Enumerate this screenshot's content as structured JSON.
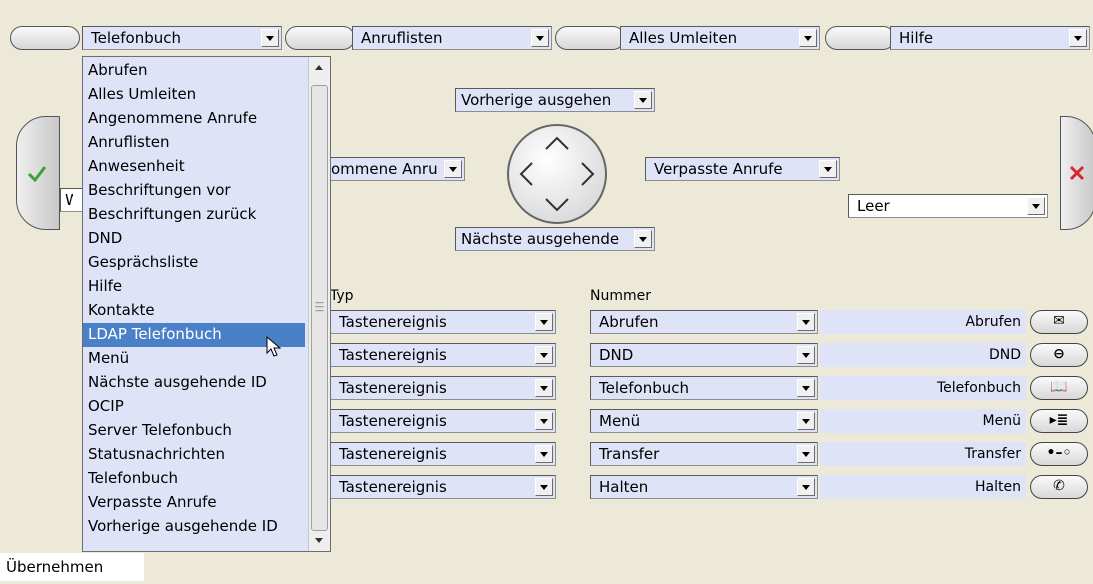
{
  "top_softkeys": [
    {
      "value": "Telefonbuch"
    },
    {
      "value": "Anruflisten"
    },
    {
      "value": "Alles Umleiten"
    },
    {
      "value": "Hilfe"
    }
  ],
  "dropdown": {
    "items": [
      "Abrufen",
      "Alles Umleiten",
      "Angenommene Anrufe",
      "Anruflisten",
      "Anwesenheit",
      "Beschriftungen vor",
      "Beschriftungen zurück",
      "DND",
      "Gesprächsliste",
      "Hilfe",
      "Kontakte",
      "LDAP Telefonbuch",
      "Menü",
      "Nächste ausgehende ID",
      "OCIP",
      "Server Telefonbuch",
      "Statusnachrichten",
      "Telefonbuch",
      "Verpasste Anrufe",
      "Vorherige ausgehende ID"
    ],
    "selected": "LDAP Telefonbuch"
  },
  "left_hidden_field": {
    "value": "W"
  },
  "navigation": {
    "up": "Vorherige ausgehen",
    "left": "ommene Anru",
    "right": "Verpasste Anrufe",
    "down": "Nächste ausgehende",
    "extra_right": "Leer"
  },
  "table": {
    "header_type": "Typ",
    "header_number": "Nummer",
    "rows": [
      {
        "type": "Tastenereignis",
        "number": "Abrufen",
        "label": "Abrufen",
        "icon": "envelope-icon",
        "glyph": "✉"
      },
      {
        "type": "Tastenereignis",
        "number": "DND",
        "label": "DND",
        "icon": "dnd-icon",
        "glyph": "⊖"
      },
      {
        "type": "Tastenereignis",
        "number": "Telefonbuch",
        "label": "Telefonbuch",
        "icon": "book-icon",
        "glyph": "📖"
      },
      {
        "type": "Tastenereignis",
        "number": "Menü",
        "label": "Menü",
        "icon": "menu-icon",
        "glyph": "▸≣"
      },
      {
        "type": "Tastenereignis",
        "number": "Transfer",
        "label": "Transfer",
        "icon": "transfer-icon",
        "glyph": "•–◦"
      },
      {
        "type": "Tastenereignis",
        "number": "Halten",
        "label": "Halten",
        "icon": "hold-icon",
        "glyph": "✆"
      }
    ]
  },
  "apply_button": "Übernehmen",
  "colors": {
    "accept": "#3aa335",
    "reject": "#d9262c",
    "selection": "#4a80c8",
    "field_bg": "#dfe3f7"
  }
}
